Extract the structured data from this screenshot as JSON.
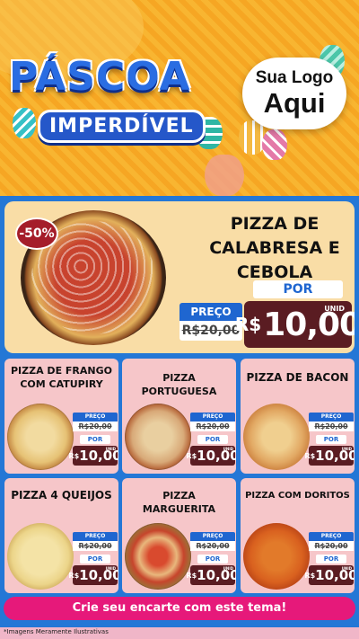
{
  "header": {
    "title": "PÁSCOA",
    "subtitle": "IMPERDÍVEL",
    "logo_line1": "Sua Logo",
    "logo_line2": "Aqui"
  },
  "featured": {
    "discount": "-50%",
    "name": "PIZZA DE CALABRESA E CEBOLA",
    "price_label": "PREÇO",
    "old_price": "R$20,00",
    "por_label": "POR",
    "currency": "R$",
    "new_price": "10,00",
    "unit": "UNID"
  },
  "products": [
    {
      "name": "PIZZA DE FRANGO COM CATUPIRY",
      "price_label": "PREÇO",
      "old_price": "R$20,00",
      "por_label": "POR",
      "currency": "R$",
      "new_price": "10,00",
      "unit": "UNID"
    },
    {
      "name": "PIZZA PORTUGUESA",
      "price_label": "PREÇO",
      "old_price": "R$20,00",
      "por_label": "POR",
      "currency": "R$",
      "new_price": "10,00",
      "unit": "UNID"
    },
    {
      "name": "PIZZA DE BACON",
      "price_label": "PREÇO",
      "old_price": "R$20,00",
      "por_label": "POR",
      "currency": "R$",
      "new_price": "10,00",
      "unit": "UNID"
    },
    {
      "name": "PIZZA 4 QUEIJOS",
      "price_label": "PREÇO",
      "old_price": "R$20,00",
      "por_label": "POR",
      "currency": "R$",
      "new_price": "10,00",
      "unit": "UNID"
    },
    {
      "name": "PIZZA MARGUERITA",
      "price_label": "PREÇO",
      "old_price": "R$20,00",
      "por_label": "POR",
      "currency": "R$",
      "new_price": "10,00",
      "unit": "UNID"
    },
    {
      "name": "PIZZA COM DORITOS",
      "price_label": "PREÇO",
      "old_price": "R$20,00",
      "por_label": "POR",
      "currency": "R$",
      "new_price": "10,00",
      "unit": "UNID"
    }
  ],
  "cta": "Crie seu encarte com este tema!",
  "footnote": "*Imagens Meramente Ilustrativas",
  "colors": {
    "accent_blue": "#2477d6",
    "price_brown": "#5a1c22",
    "cta_pink": "#e6197a",
    "card_pink": "#f6c6c9"
  }
}
